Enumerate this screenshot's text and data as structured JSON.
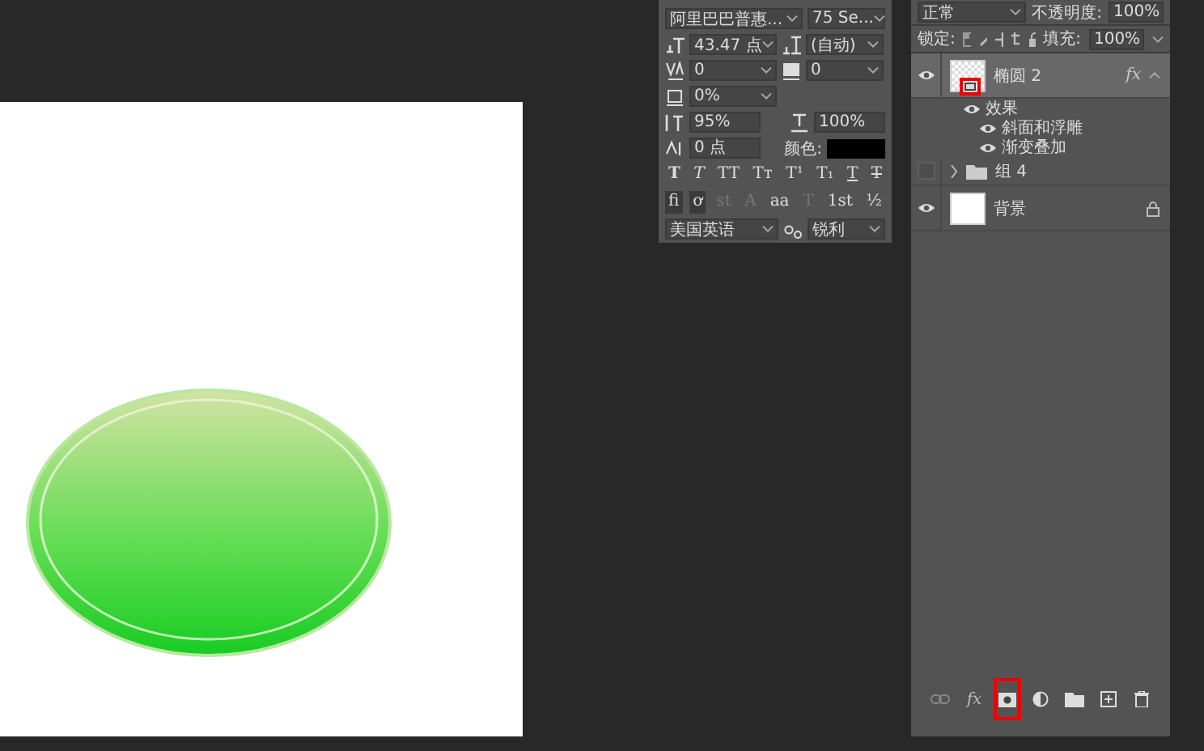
{
  "character_panel": {
    "font_family": "阿里巴巴普惠...",
    "font_style": "75 Se...",
    "font_size": "43.47 点",
    "leading": "(自动)",
    "kerning": "0",
    "tracking": "0",
    "tsume": "0%",
    "vertical_scale": "95%",
    "horizontal_scale": "100%",
    "baseline_shift": "0 点",
    "color_label": "颜色:",
    "style_buttons": [
      {
        "label": "T",
        "kind": "bold"
      },
      {
        "label": "T",
        "kind": "italic"
      },
      {
        "label": "TT",
        "kind": "caps"
      },
      {
        "label": "Tт",
        "kind": "smallcaps"
      },
      {
        "label": "T¹",
        "kind": "super"
      },
      {
        "label": "T₁",
        "kind": "sub"
      },
      {
        "label": "T",
        "kind": "underline"
      },
      {
        "label": "T",
        "kind": "strike"
      }
    ],
    "opentype_buttons": [
      {
        "label": "fi",
        "selected": true,
        "disabled": false
      },
      {
        "label": "ơ",
        "selected": true,
        "disabled": false
      },
      {
        "label": "st",
        "selected": false,
        "disabled": true
      },
      {
        "label": "A",
        "selected": false,
        "disabled": true
      },
      {
        "label": "aa",
        "selected": false,
        "disabled": false
      },
      {
        "label": "T",
        "selected": false,
        "disabled": true
      },
      {
        "label": "1st",
        "selected": false,
        "disabled": false
      },
      {
        "label": "½",
        "selected": false,
        "disabled": false
      }
    ],
    "language": "美国英语",
    "antialias": "锐利"
  },
  "layers_panel": {
    "blend_mode": "正常",
    "opacity_label": "不透明度:",
    "opacity": "100%",
    "lock_label": "锁定:",
    "fill_label": "填充:",
    "fill": "100%",
    "layers": [
      {
        "kind": "layer",
        "name": "椭圆 2",
        "visible": true,
        "selected": true,
        "transparent": true,
        "fx": "fx",
        "badge_highlighted": true,
        "locked": false,
        "effects": {
          "name": "效果",
          "visible": true,
          "items": [
            {
              "name": "斜面和浮雕",
              "visible": true
            },
            {
              "name": "渐变叠加",
              "visible": true
            }
          ]
        }
      },
      {
        "kind": "group",
        "name": "组 4",
        "visible": false,
        "selected": false,
        "expanded": false
      },
      {
        "kind": "layer",
        "name": "背景",
        "visible": true,
        "selected": false,
        "transparent": false,
        "locked": true
      }
    ],
    "toolbar": [
      {
        "kind": "link",
        "highlighted": false
      },
      {
        "kind": "fx",
        "label": "fx",
        "highlighted": false
      },
      {
        "kind": "mask",
        "highlighted": true
      },
      {
        "kind": "adjust",
        "highlighted": false
      },
      {
        "kind": "folder",
        "highlighted": false
      },
      {
        "kind": "new",
        "highlighted": false
      },
      {
        "kind": "trash",
        "highlighted": false
      }
    ]
  }
}
